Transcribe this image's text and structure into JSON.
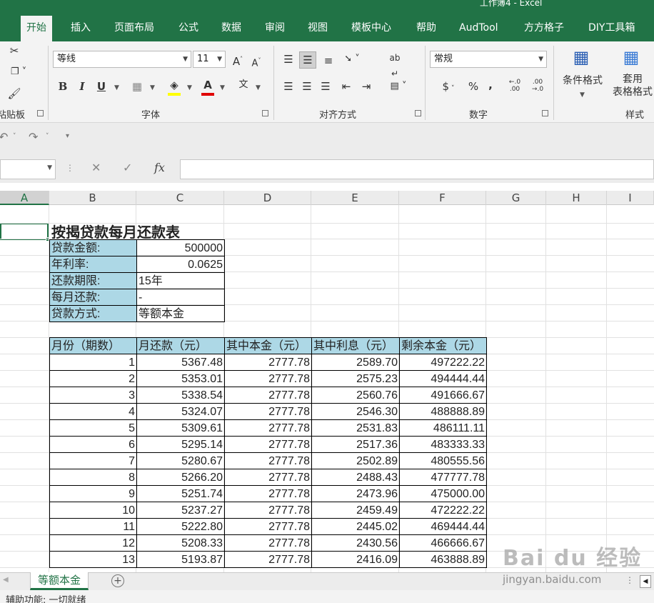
{
  "window_title": "工作簿4  -  Excel",
  "tabs": [
    "开始",
    "插入",
    "页面布局",
    "公式",
    "数据",
    "审阅",
    "视图",
    "模板中心",
    "帮助",
    "AudTool",
    "方方格子",
    "DIY工具箱"
  ],
  "ribbon": {
    "clipboard_label": "粘贴板",
    "font_group_label": "字体",
    "align_group_label": "对齐方式",
    "number_group_label": "数字",
    "styles_group_label": "样式",
    "font_name": "等线",
    "font_size": "11",
    "increase_font": "A",
    "decrease_font": "A",
    "bold": "B",
    "italic": "I",
    "underline": "U",
    "font_color_letter": "A",
    "phonetic": "文",
    "number_format": "常规",
    "currency": "$",
    "percent": "%",
    "comma": ",",
    "conditional_format": "条件格式",
    "table_format_line1": "套用",
    "table_format_line2": "表格格式"
  },
  "formula_bar": {
    "fx": "fx",
    "value": ""
  },
  "grid": {
    "columns": [
      "A",
      "B",
      "C",
      "D",
      "E",
      "F",
      "G",
      "H",
      "I"
    ],
    "selected_column": "A",
    "title": "按揭贷款每月还款表",
    "info": [
      {
        "label": "贷款金额:",
        "value": "500000"
      },
      {
        "label": "年利率:",
        "value": "0.0625"
      },
      {
        "label": "还款期限:",
        "value": "15年"
      },
      {
        "label": "每月还款:",
        "value": "-"
      },
      {
        "label": "贷款方式:",
        "value": "等额本金"
      }
    ],
    "table_headers": [
      "月份（期数）",
      "月还款（元）",
      "其中本金（元）",
      "其中利息（元）",
      "剩余本金（元）"
    ],
    "rows": [
      [
        "1",
        "5367.48",
        "2777.78",
        "2589.70",
        "497222.22"
      ],
      [
        "2",
        "5353.01",
        "2777.78",
        "2575.23",
        "494444.44"
      ],
      [
        "3",
        "5338.54",
        "2777.78",
        "2560.76",
        "491666.67"
      ],
      [
        "4",
        "5324.07",
        "2777.78",
        "2546.30",
        "488888.89"
      ],
      [
        "5",
        "5309.61",
        "2777.78",
        "2531.83",
        "486111.11"
      ],
      [
        "6",
        "5295.14",
        "2777.78",
        "2517.36",
        "483333.33"
      ],
      [
        "7",
        "5280.67",
        "2777.78",
        "2502.89",
        "480555.56"
      ],
      [
        "8",
        "5266.20",
        "2777.78",
        "2488.43",
        "477777.78"
      ],
      [
        "9",
        "5251.74",
        "2777.78",
        "2473.96",
        "475000.00"
      ],
      [
        "10",
        "5237.27",
        "2777.78",
        "2459.49",
        "472222.22"
      ],
      [
        "11",
        "5222.80",
        "2777.78",
        "2445.02",
        "469444.44"
      ],
      [
        "12",
        "5208.33",
        "2777.78",
        "2430.56",
        "466666.67"
      ],
      [
        "13",
        "5193.87",
        "2777.78",
        "2416.09",
        "463888.89"
      ]
    ]
  },
  "sheet_tabs": {
    "active": "等额本金",
    "add": "+"
  },
  "status": {
    "text": "辅助功能: 一切就绪"
  },
  "watermark": {
    "brand": "Bai du 经验",
    "url": "jingyan.baidu.com"
  }
}
